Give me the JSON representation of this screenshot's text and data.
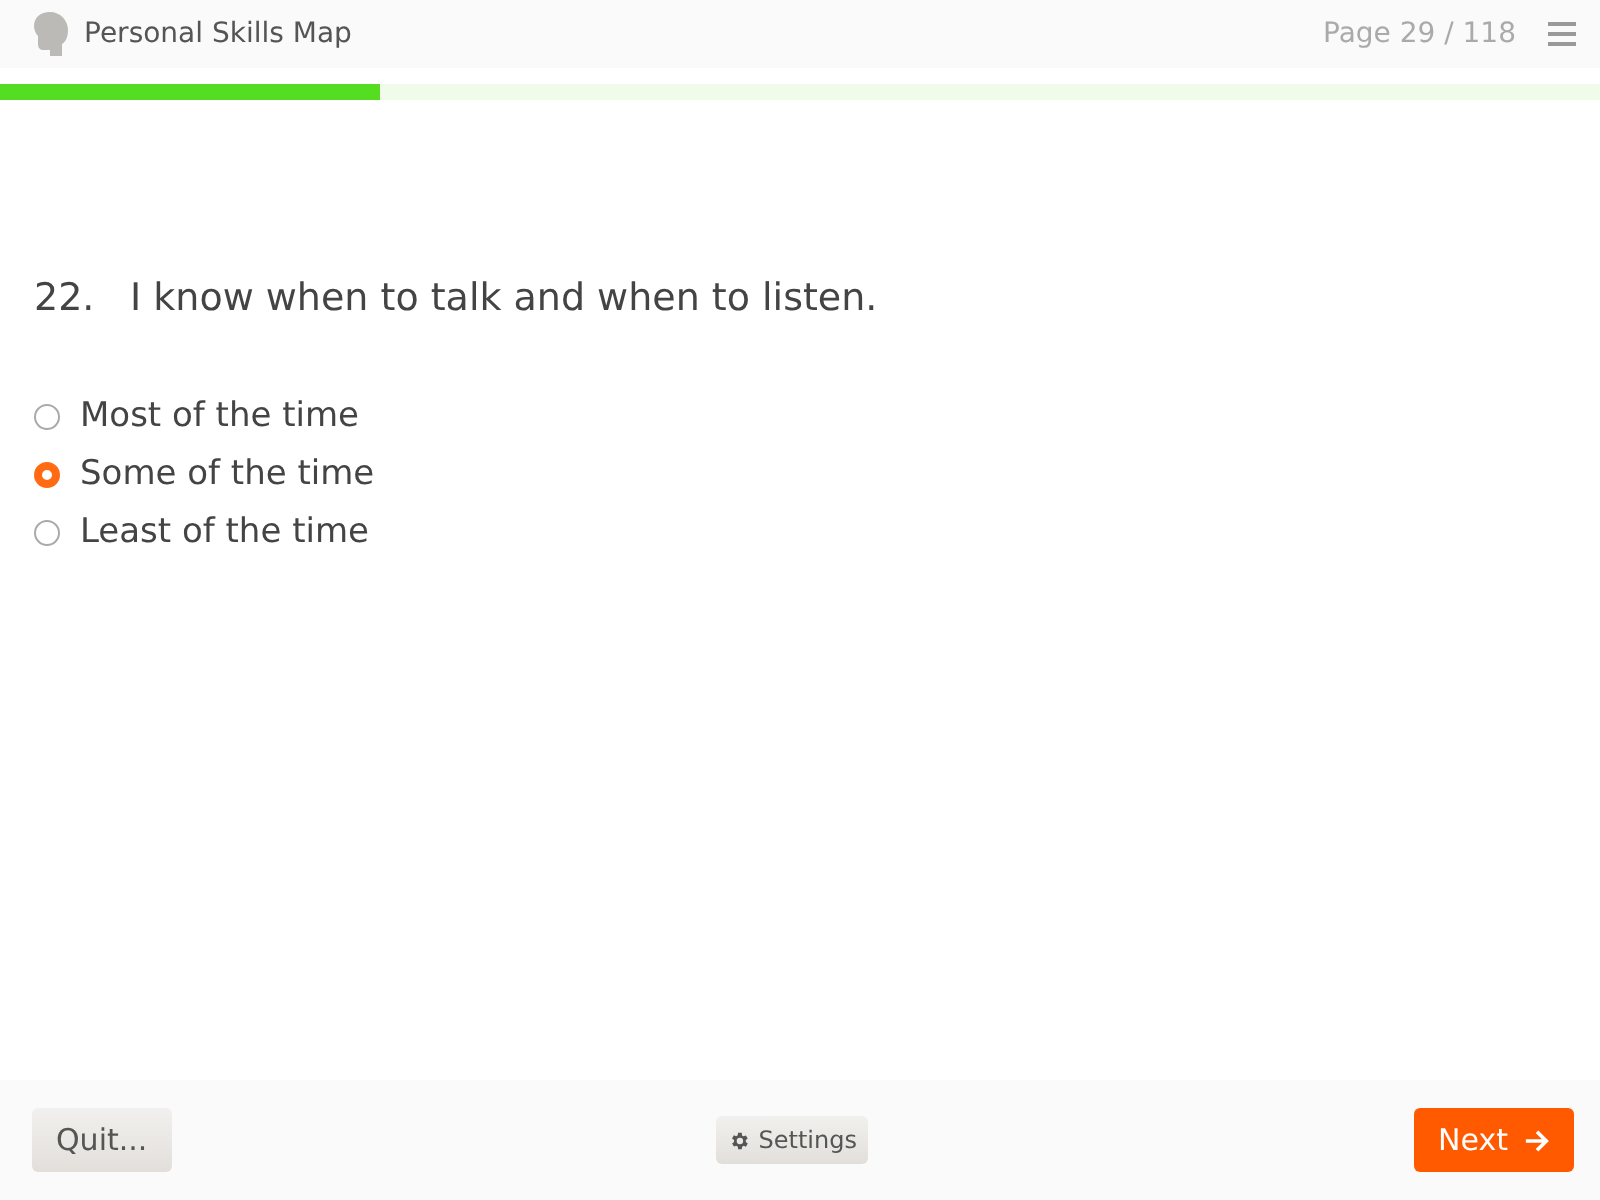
{
  "header": {
    "title": "Personal Skills Map",
    "page": "Page 29 / 118"
  },
  "progress": {
    "level": 0.2375
  },
  "question": {
    "number": "22.",
    "text": "I know when to talk and when to listen."
  },
  "options": [
    {
      "label": "Most of the time",
      "selected": false
    },
    {
      "label": "Some of the time",
      "selected": true
    },
    {
      "label": "Least of the time",
      "selected": false
    }
  ],
  "footer": {
    "quit": "Quit...",
    "settings": "Settings",
    "next": "Next"
  }
}
